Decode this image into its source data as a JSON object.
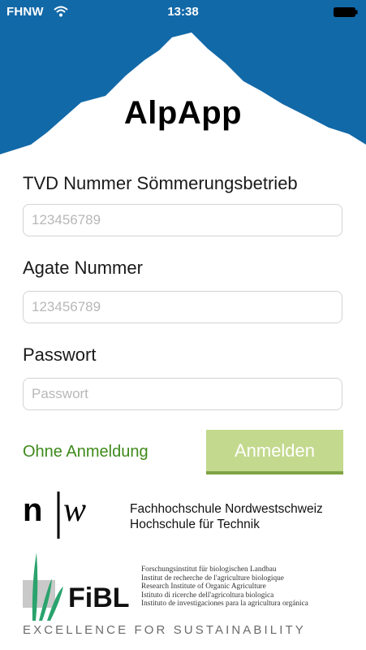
{
  "status_bar": {
    "carrier": "FHNW",
    "time": "13:38"
  },
  "app": {
    "title": "AlpApp"
  },
  "form": {
    "tvd_label": "TVD Nummer Sömmerungsbetrieb",
    "tvd_placeholder": "123456789",
    "agate_label": "Agate Nummer",
    "agate_placeholder": "123456789",
    "password_label": "Passwort",
    "password_placeholder": "Passwort"
  },
  "actions": {
    "guest_link": "Ohne Anmeldung",
    "login_button": "Anmelden"
  },
  "footer": {
    "fhnw_lines": [
      "Fachhochschule Nordwestschweiz",
      "Hochschule für Technik"
    ],
    "fibl_name": "FiBL",
    "fibl_lines": [
      "Forschungsinstitut für biologischen Landbau",
      "Institut de recherche de l'agriculture biologique",
      "Research Institute of Organic Agriculture",
      "Istituto di ricerche dell'agricoltura biologica",
      "Instituto de investigaciones para la agricultura orgánica"
    ],
    "slogan": "EXCELLENCE FOR SUSTAINABILITY"
  },
  "colors": {
    "header_blue": "#1269a8",
    "link_green": "#3f8a1b",
    "button_green": "#c3d98e",
    "button_shadow": "#7fa443",
    "fibl_green": "#2aa36d"
  }
}
